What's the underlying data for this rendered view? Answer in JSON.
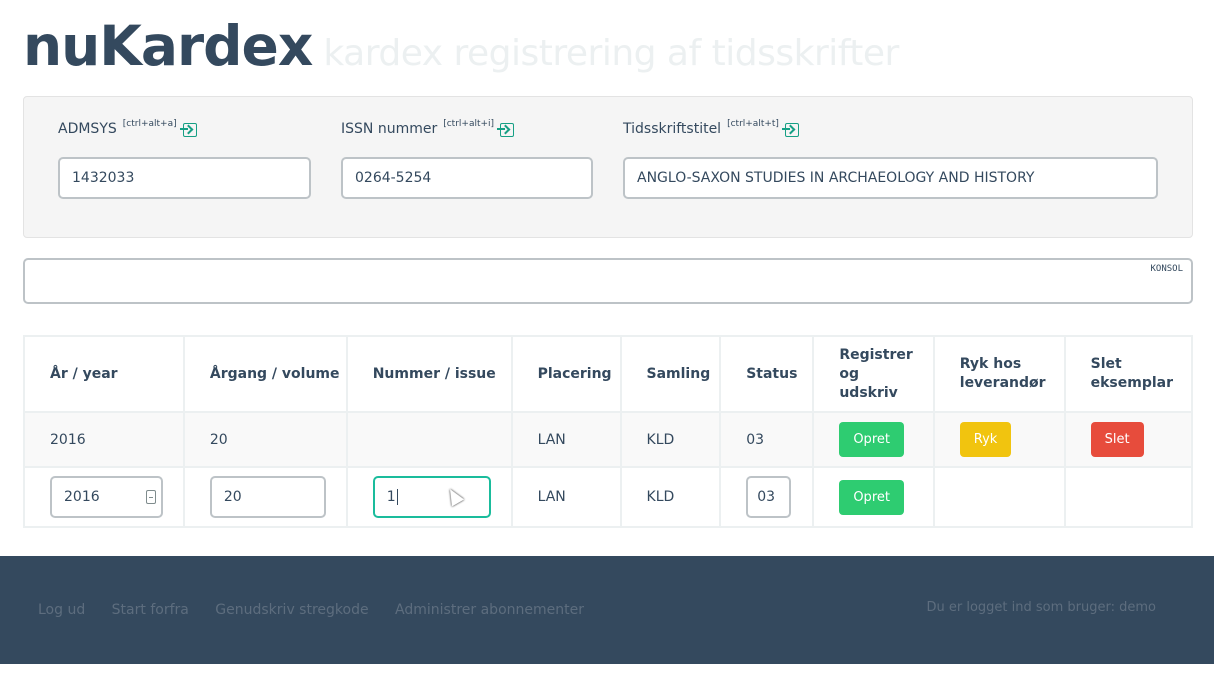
{
  "header": {
    "brand": "nuKardex",
    "subtitle": "kardex registrering af tidsskrifter"
  },
  "lookup": {
    "admsys": {
      "label": "ADMSYS",
      "shortcut": "[ctrl+alt+a]",
      "value": "1432033"
    },
    "issn": {
      "label": "ISSN nummer",
      "shortcut": "[ctrl+alt+i]",
      "value": "0264-5254"
    },
    "title": {
      "label": "Tidsskriftstitel",
      "shortcut": "[ctrl+alt+t]",
      "value": "ANGLO-SAXON STUDIES IN ARCHAEOLOGY AND HISTORY"
    }
  },
  "console": {
    "label": "KONSOL"
  },
  "table": {
    "headers": {
      "year": "År / year",
      "volume": "Årgang / volume",
      "issue": "Nummer / issue",
      "placement": "Placering",
      "collection": "Samling",
      "status": "Status",
      "register": "Registrer og udskriv",
      "claim": "Ryk hos leverandør",
      "delete": "Slet eksemplar"
    },
    "row1": {
      "year": "2016",
      "volume": "20",
      "issue": "",
      "placement": "LAN",
      "collection": "KLD",
      "status": "03",
      "register_btn": "Opret",
      "claim_btn": "Ryk",
      "delete_btn": "Slet"
    },
    "row2": {
      "year": "2016",
      "volume": "20",
      "issue": "1",
      "placement": "LAN",
      "collection": "KLD",
      "status": "03",
      "register_btn": "Opret"
    }
  },
  "footer": {
    "links": [
      "Log ud",
      "Start forfra",
      "Genudskriv stregkode",
      "Administrer abonnementer"
    ],
    "user": "Du er logget ind som bruger: demo"
  }
}
